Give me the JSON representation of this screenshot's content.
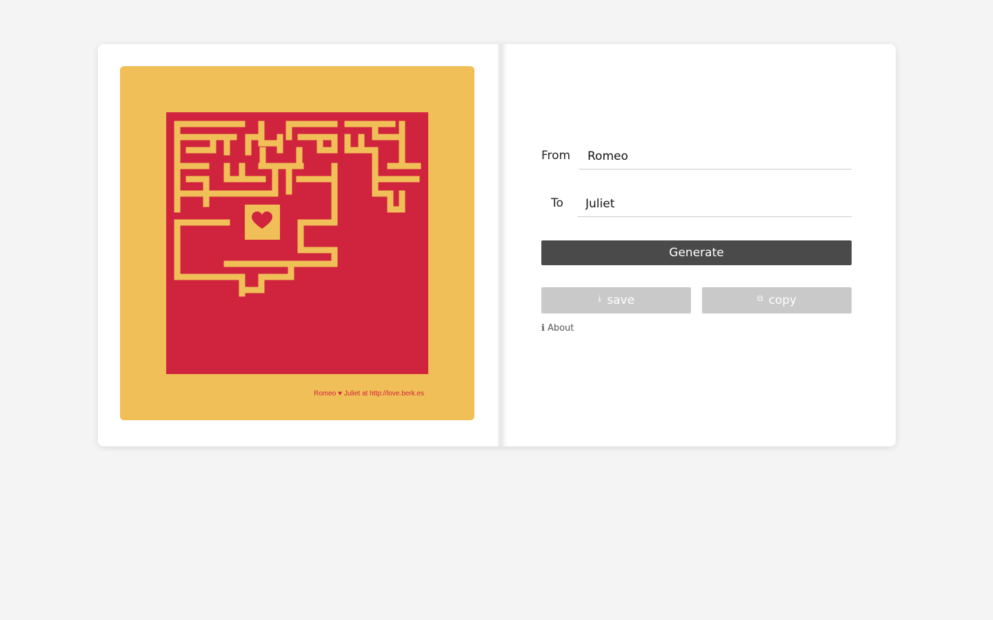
{
  "poster": {
    "caption": "Romeo ♥ Juliet at http://love.berk.es",
    "colors": {
      "background": "#f1bf57",
      "maze": "#d0233d"
    }
  },
  "form": {
    "from_label": "From",
    "from_value": "Romeo",
    "to_label": "To",
    "to_value": "Juliet"
  },
  "actions": {
    "generate_label": "Generate",
    "save_icon": "⤓",
    "save_label": "save",
    "copy_icon": "⧉",
    "copy_label": "copy"
  },
  "about": {
    "icon": "ℹ",
    "label": "About"
  },
  "icons": {
    "save": "download-icon",
    "copy": "copy-icon",
    "about": "info-icon",
    "poster": "heart-icon"
  }
}
